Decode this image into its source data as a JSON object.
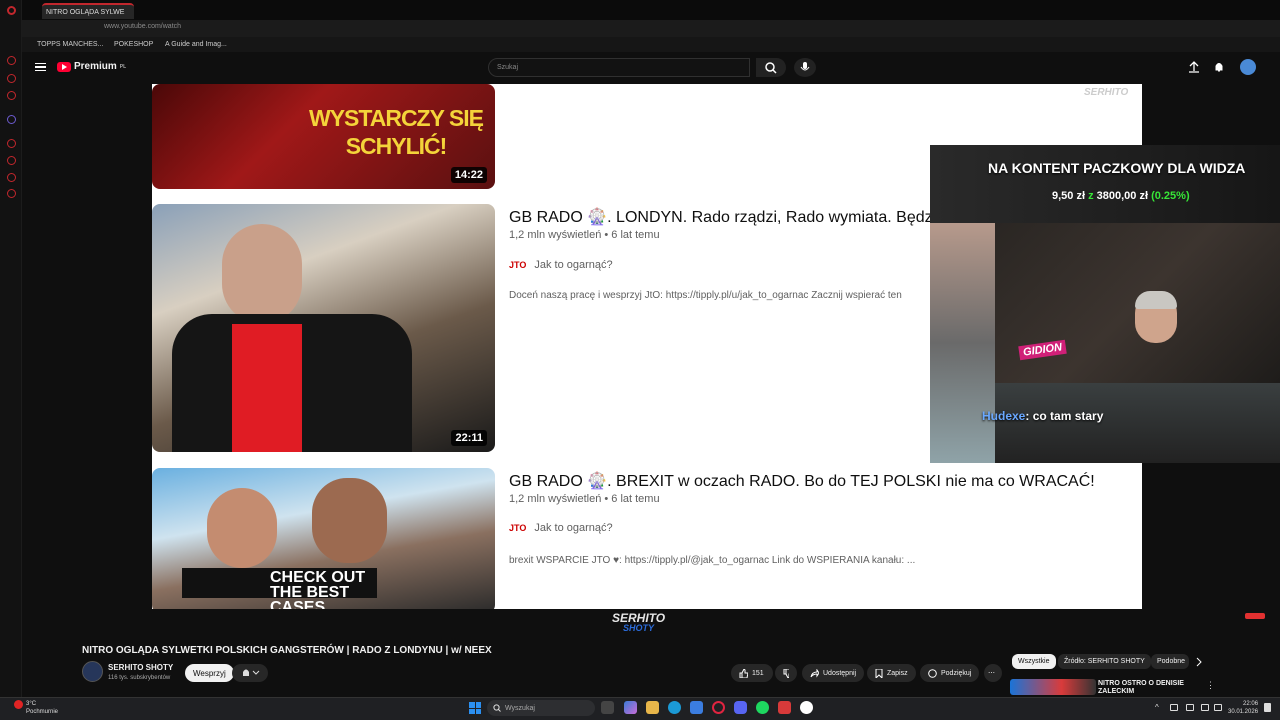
{
  "browser": {
    "tab_title": "NITRO OGLĄDA SYLWE",
    "url": "www.youtube.com/watch",
    "bookmarks": [
      "TOPPS MANCHES...",
      "POKESHOP",
      "A Guide and Imag..."
    ]
  },
  "youtube": {
    "logo_text": "Premium",
    "logo_sup": "PL",
    "search_placeholder": "Szukaj"
  },
  "video_content": {
    "items": [
      {
        "thumb_text": "WYSTARCZY SIĘ SCHYLIĆ!",
        "duration": "14:22"
      },
      {
        "title": "GB RADO 🎡. LONDYN. Rado rządzi, Rado wymiata. Będziec",
        "views": "1,2 mln wyświetleń • 6 lat temu",
        "channel": "Jak to ogarnąć?",
        "channel_avatar": "JTO",
        "desc": "Doceń naszą pracę i wesprzyj JtO: https://tipply.pl/u/jak_to_ogarnac Zacznij wspierać ten",
        "duration": "22:11"
      },
      {
        "title": "GB RADO 🎡. BREXIT w oczach RADO. Bo do TEJ POLSKI nie ma co WRACAĆ!",
        "views": "1,2 mln wyświetleń • 6 lat temu",
        "channel": "Jak to ogarnąć?",
        "channel_avatar": "JTO",
        "desc": "brexit WSPARCIE JTO ♥: https://tipply.pl/@jak_to_ogarnac Link do WSPIERANIA kanału: ...",
        "promo": "CHECK OUT THE BEST CASES"
      }
    ],
    "watermark": "SERHITO"
  },
  "stream_overlay": {
    "donation_headline": "NA KONTENT PACZKOWY DLA WIDZA",
    "donation_amount": "9,50 zł",
    "donation_of": "z",
    "donation_goal": "3800,00 zł",
    "donation_percent": "(0.25%)",
    "chat_user": "Hudexe",
    "chat_text": ": co tam stary",
    "cam_tag": "GIDION"
  },
  "under_video": {
    "logo_line1": "SERHITO",
    "logo_line2": "SHOTY",
    "title": "NITRO OGLĄDA SYLWETKI POLSKICH GANGSTERÓW | RADO Z LONDYNU | w/ NEEX",
    "channel_name": "SERHITO SHOTY",
    "subscribers": "116 tys. subskrybentów",
    "join_label": "Wesprzyj",
    "likes": "151",
    "share_label": "Udostępnij",
    "save_label": "Zapisz",
    "thanks_label": "Podziękuj",
    "more_label": "⋯"
  },
  "chips": [
    "Wszystkie",
    "Źródło: SERHITO SHOTY",
    "Podobne"
  ],
  "suggestion_title": "NITRO OSTRO O DENISIE ZALECKIM",
  "taskbar": {
    "temp": "3°C",
    "weather": "Pochmurnie",
    "search": "Wyszukaj",
    "time": "22:06",
    "date": "30.01.2026"
  },
  "colors": {
    "accent": "#c2272d",
    "yt_red": "#ff0033",
    "progress_green": "#37e637"
  }
}
